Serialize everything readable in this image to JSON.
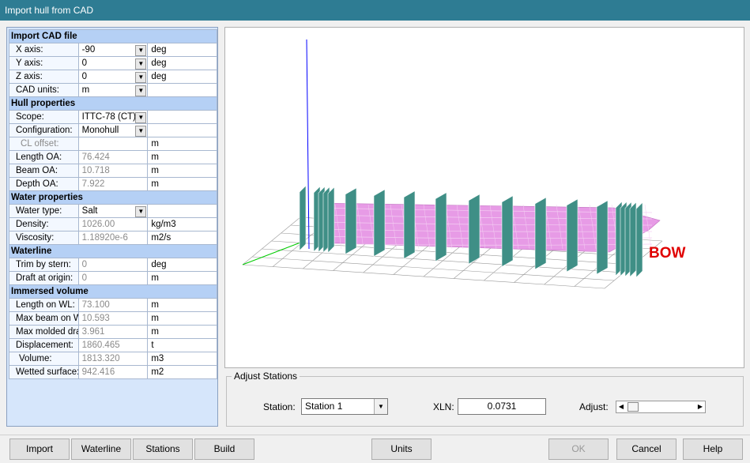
{
  "window": {
    "title": "Import hull from CAD"
  },
  "properties": [
    {
      "type": "section",
      "label": "Import CAD file"
    },
    {
      "type": "row",
      "label": "X axis:",
      "value": "-90",
      "unit": "deg",
      "combo": true
    },
    {
      "type": "row",
      "label": "Y axis:",
      "value": "0",
      "unit": "deg",
      "combo": true
    },
    {
      "type": "row",
      "label": "Z axis:",
      "value": "0",
      "unit": "deg",
      "combo": true
    },
    {
      "type": "row",
      "label": "CAD units:",
      "value": "m",
      "unit": "",
      "combo": true
    },
    {
      "type": "section",
      "label": "Hull properties"
    },
    {
      "type": "row",
      "label": "Scope:",
      "value": "ITTC-78 (CT)",
      "unit": "",
      "combo": true
    },
    {
      "type": "row",
      "label": "Configuration:",
      "value": "Monohull",
      "unit": "",
      "combo": true
    },
    {
      "type": "row",
      "label": "CL offset:",
      "value": "",
      "unit": "m",
      "disabled": true,
      "labelDisabled": true
    },
    {
      "type": "row",
      "label": "Length OA:",
      "value": "76.424",
      "unit": "m",
      "disabled": true
    },
    {
      "type": "row",
      "label": "Beam OA:",
      "value": "10.718",
      "unit": "m",
      "disabled": true
    },
    {
      "type": "row",
      "label": "Depth OA:",
      "value": "7.922",
      "unit": "m",
      "disabled": true
    },
    {
      "type": "section",
      "label": "Water properties"
    },
    {
      "type": "row",
      "label": "Water type:",
      "value": "Salt",
      "unit": "",
      "combo": true
    },
    {
      "type": "row",
      "label": "Density:",
      "value": "1026.00",
      "unit": "kg/m3",
      "disabled": true
    },
    {
      "type": "row",
      "label": "Viscosity:",
      "value": "1.18920e-6",
      "unit": "m2/s",
      "disabled": true
    },
    {
      "type": "section",
      "label": "Waterline"
    },
    {
      "type": "row",
      "label": "Trim by stern:",
      "value": "0",
      "unit": "deg",
      "disabled": true
    },
    {
      "type": "row",
      "label": "Draft at origin:",
      "value": "0",
      "unit": "m",
      "disabled": true
    },
    {
      "type": "section",
      "label": "Immersed volume"
    },
    {
      "type": "row",
      "label": "Length on WL:",
      "value": "73.100",
      "unit": "m",
      "disabled": true
    },
    {
      "type": "row",
      "label": "Max beam on WL:",
      "value": "10.593",
      "unit": "m",
      "disabled": true
    },
    {
      "type": "row",
      "label": "Max molded draft:",
      "value": "3.961",
      "unit": "m",
      "disabled": true
    },
    {
      "type": "row",
      "label": "Displacement:",
      "value": "1860.465",
      "unit": "t",
      "disabled": true
    },
    {
      "type": "row",
      "label": "Volume:",
      "value": "1813.320",
      "unit": "m3",
      "disabled": true,
      "indent": true
    },
    {
      "type": "row",
      "label": "Wetted surface:",
      "value": "942.416",
      "unit": "m2",
      "disabled": true
    }
  ],
  "viewer": {
    "bow_label": "BOW",
    "hull_color": "#e79be6",
    "station_color": "#3f8f86",
    "axis_z_color": "#0000ff",
    "axis_y_color": "#00cc00"
  },
  "adjust": {
    "group_label": "Adjust Stations",
    "station_label": "Station:",
    "station_value": "Station 1",
    "xln_label": "XLN:",
    "xln_value": "0.0731",
    "adjust_label": "Adjust:"
  },
  "buttons": {
    "import": "Import",
    "waterline": "Waterline",
    "stations": "Stations",
    "build": "Build",
    "units": "Units",
    "ok": "OK",
    "cancel": "Cancel",
    "help": "Help"
  }
}
